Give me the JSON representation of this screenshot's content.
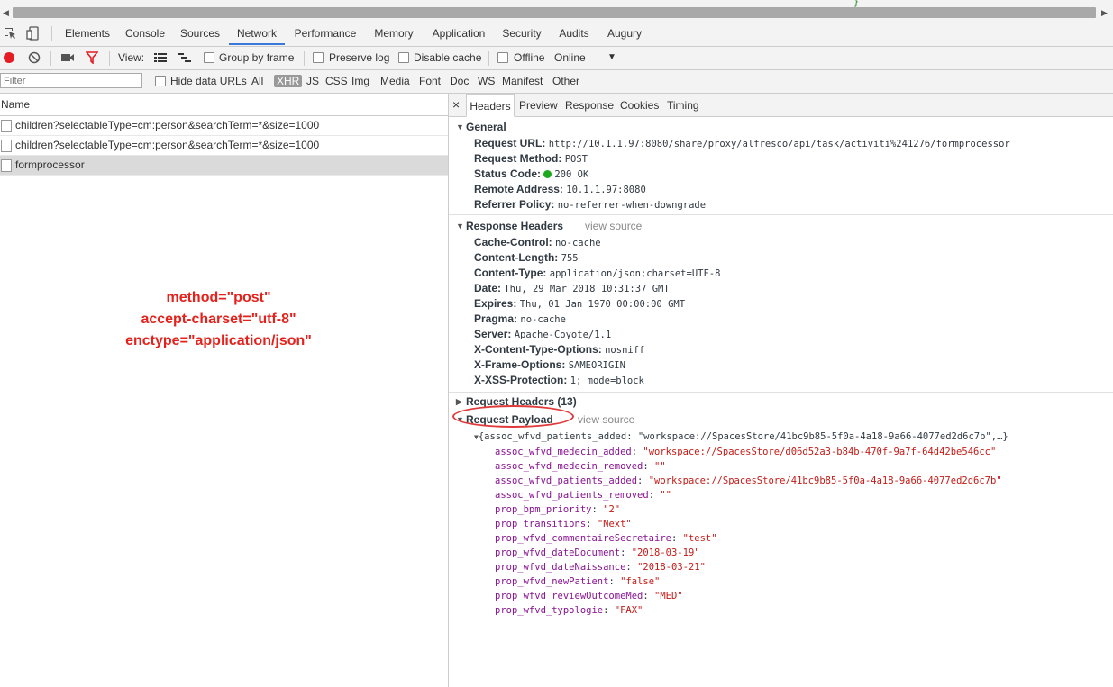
{
  "tabs": [
    "Elements",
    "Console",
    "Sources",
    "Network",
    "Performance",
    "Memory",
    "Application",
    "Security",
    "Audits",
    "Augury"
  ],
  "active_tab": "Network",
  "toolbar": {
    "view_label": "View:",
    "group_by_frame": "Group by frame",
    "preserve_log": "Preserve log",
    "disable_cache": "Disable cache",
    "offline": "Offline",
    "throttle": "Online"
  },
  "filterbar": {
    "placeholder": "Filter",
    "hide_data_urls": "Hide data URLs",
    "types": [
      "All",
      "XHR",
      "JS",
      "CSS",
      "Img",
      "Media",
      "Font",
      "Doc",
      "WS",
      "Manifest",
      "Other"
    ],
    "active_type": "XHR"
  },
  "requests": {
    "header": "Name",
    "items": [
      "children?selectableType=cm:person&searchTerm=*&size=1000",
      "children?selectableType=cm:person&searchTerm=*&size=1000",
      "formprocessor"
    ]
  },
  "annotation": {
    "line1": "method=\"post\"",
    "line2": "accept-charset=\"utf-8\"",
    "line3": "enctype=\"application/json\""
  },
  "detail_tabs": [
    "Headers",
    "Preview",
    "Response",
    "Cookies",
    "Timing"
  ],
  "close_glyph": "×",
  "general": {
    "title": "General",
    "rows": [
      {
        "k": "Request URL:",
        "v": "http://10.1.1.97:8080/share/proxy/alfresco/api/task/activiti%241276/formprocessor"
      },
      {
        "k": "Request Method:",
        "v": "POST"
      },
      {
        "k": "Status Code:",
        "v": "200 OK"
      },
      {
        "k": "Remote Address:",
        "v": "10.1.1.97:8080"
      },
      {
        "k": "Referrer Policy:",
        "v": "no-referrer-when-downgrade"
      }
    ]
  },
  "response_headers": {
    "title": "Response Headers",
    "view_source": "view source",
    "rows": [
      {
        "k": "Cache-Control:",
        "v": "no-cache"
      },
      {
        "k": "Content-Length:",
        "v": "755"
      },
      {
        "k": "Content-Type:",
        "v": "application/json;charset=UTF-8"
      },
      {
        "k": "Date:",
        "v": "Thu, 29 Mar 2018 10:31:37 GMT"
      },
      {
        "k": "Expires:",
        "v": "Thu, 01 Jan 1970 00:00:00 GMT"
      },
      {
        "k": "Pragma:",
        "v": "no-cache"
      },
      {
        "k": "Server:",
        "v": "Apache-Coyote/1.1"
      },
      {
        "k": "X-Content-Type-Options:",
        "v": "nosniff"
      },
      {
        "k": "X-Frame-Options:",
        "v": "SAMEORIGIN"
      },
      {
        "k": "X-XSS-Protection:",
        "v": "1; mode=block"
      }
    ]
  },
  "request_headers": {
    "title": "Request Headers (13)"
  },
  "payload": {
    "title": "Request Payload",
    "view_source": "view source",
    "summary": "{assoc_wfvd_patients_added: \"workspace://SpacesStore/41bc9b85-5f0a-4a18-9a66-4077ed2d6c7b\",…}",
    "rows": [
      {
        "k": "assoc_wfvd_medecin_added",
        "v": "\"workspace://SpacesStore/d06d52a3-b84b-470f-9a7f-64d42be546cc\""
      },
      {
        "k": "assoc_wfvd_medecin_removed",
        "v": "\"\""
      },
      {
        "k": "assoc_wfvd_patients_added",
        "v": "\"workspace://SpacesStore/41bc9b85-5f0a-4a18-9a66-4077ed2d6c7b\""
      },
      {
        "k": "assoc_wfvd_patients_removed",
        "v": "\"\""
      },
      {
        "k": "prop_bpm_priority",
        "v": "\"2\""
      },
      {
        "k": "prop_transitions",
        "v": "\"Next\""
      },
      {
        "k": "prop_wfvd_commentaireSecretaire",
        "v": "\"test\""
      },
      {
        "k": "prop_wfvd_dateDocument",
        "v": "\"2018-03-19\""
      },
      {
        "k": "prop_wfvd_dateNaissance",
        "v": "\"2018-03-21\""
      },
      {
        "k": "prop_wfvd_newPatient",
        "v": "\"false\""
      },
      {
        "k": "prop_wfvd_reviewOutcomeMed",
        "v": "\"MED\""
      },
      {
        "k": "prop_wfvd_typologie",
        "v": "\"FAX\""
      }
    ]
  },
  "colors": {
    "accent": "#3879d9",
    "annotation": "#e5211c",
    "ellipse": "#e03a3a",
    "status_ok": "#1da91d"
  }
}
